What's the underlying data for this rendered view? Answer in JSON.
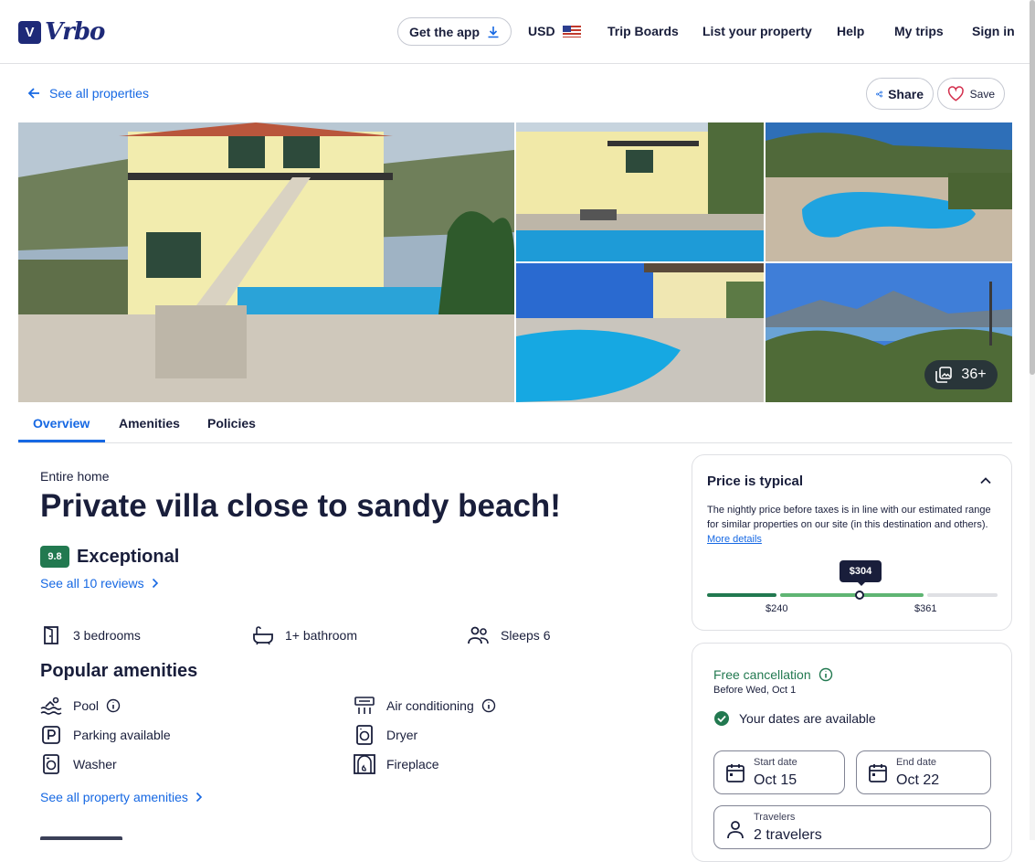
{
  "header": {
    "logo_text": "Vrbo",
    "logo_mark": "V",
    "get_app": "Get the app",
    "currency": "USD",
    "nav": [
      "Trip Boards",
      "List your property",
      "Help",
      "My trips",
      "Sign in"
    ]
  },
  "subheader": {
    "back_label": "See all properties",
    "share_label": "Share",
    "save_label": "Save"
  },
  "gallery": {
    "more_count": "36+"
  },
  "tabs": [
    "Overview",
    "Amenities",
    "Policies"
  ],
  "listing": {
    "type": "Entire home",
    "title": "Private villa close to sandy beach!",
    "rating": "9.8",
    "rating_label": "Exceptional",
    "reviews_link": "See all 10 reviews",
    "facts": [
      "3 bedrooms",
      "1+ bathroom",
      "Sleeps 6"
    ]
  },
  "amenities": {
    "heading": "Popular amenities",
    "items": [
      {
        "label": "Pool",
        "icon": "pool-icon"
      },
      {
        "label": "Air conditioning",
        "icon": "air-conditioning-icon"
      },
      {
        "label": "Parking available",
        "icon": "parking-icon"
      },
      {
        "label": "Dryer",
        "icon": "dryer-icon"
      },
      {
        "label": "Washer",
        "icon": "washer-icon"
      },
      {
        "label": "Fireplace",
        "icon": "fireplace-icon"
      }
    ],
    "see_all": "See all property amenities"
  },
  "price_card": {
    "title": "Price is typical",
    "description": "The nightly price before taxes is in line with our estimated range for similar properties on our site (in this destination and others).",
    "more_details": "More details",
    "current_price": "$304",
    "low": "$240",
    "high": "$361",
    "colors": {
      "low": "#227950",
      "mid": "#5fb573",
      "high": "#dfe0e4"
    }
  },
  "booking": {
    "free_cancellation": "Free cancellation",
    "before_date": "Before Wed, Oct 1",
    "availability": "Your dates are available",
    "start_label": "Start date",
    "start_value": "Oct 15",
    "end_label": "End date",
    "end_value": "Oct 22",
    "travelers_label": "Travelers",
    "travelers_value": "2 travelers"
  },
  "colors": {
    "accent": "#1668e3",
    "brand": "#1e2a78",
    "success": "#227950"
  }
}
